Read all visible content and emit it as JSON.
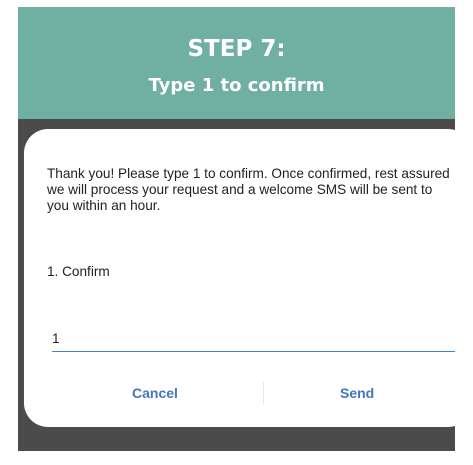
{
  "banner": {
    "step": "STEP 7:",
    "subtitle": "Type 1 to confirm"
  },
  "dialog": {
    "message": "Thank you! Please type 1 to confirm. Once confirmed, rest assured we will process your request and a welcome SMS will be sent to you within an hour.",
    "option": "1. Confirm",
    "input_value": "1",
    "cancel_label": "Cancel",
    "send_label": "Send"
  },
  "colors": {
    "banner_bg": "#6fb0a2",
    "screen_bg": "#4b4b4b",
    "accent": "#3f86c8",
    "button_text": "#4477bb"
  }
}
